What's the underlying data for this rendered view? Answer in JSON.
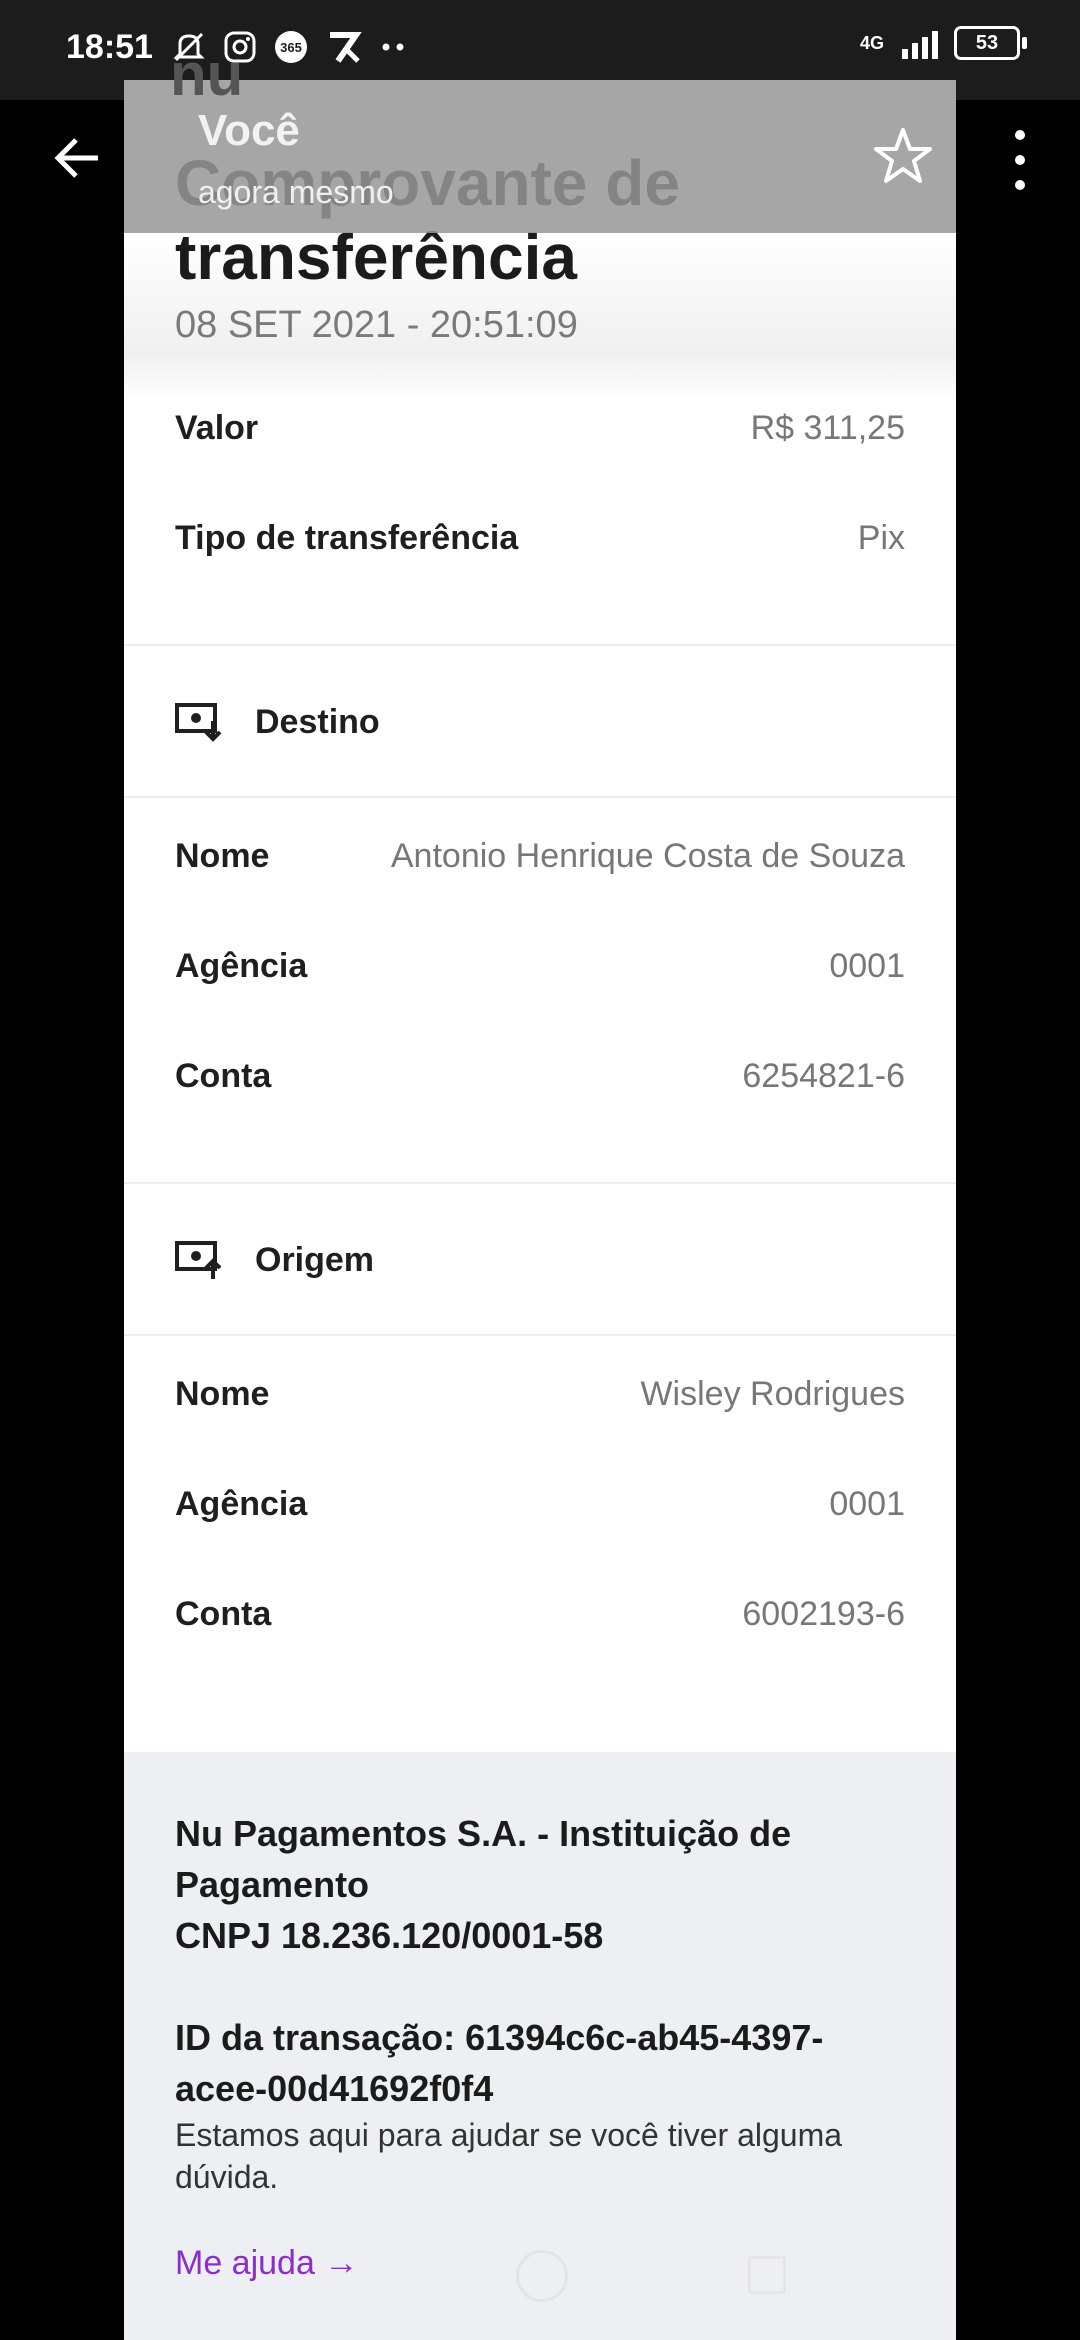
{
  "status_bar": {
    "time": "18:51",
    "icons": [
      "mute-bell-icon",
      "instagram-icon",
      "app-365-icon",
      "app-7-icon",
      "more-dots-icon"
    ],
    "network": "4G",
    "battery": "53"
  },
  "overlay": {
    "title": "Você",
    "subtitle": "agora mesmo"
  },
  "toolbar": {
    "back_icon": "arrow-left-icon",
    "star_icon": "star-outline-icon",
    "menu_icon": "more-vertical-icon"
  },
  "receipt": {
    "title": "Comprovante de transferência",
    "date": "08 SET 2021 - 20:51:09",
    "value_label": "Valor",
    "value": "R$ 311,25",
    "type_label": "Tipo de transferência",
    "type_value": "Pix"
  },
  "destino": {
    "heading": "Destino",
    "name_label": "Nome",
    "name": "Antonio Henrique Costa de Souza",
    "agency_label": "Agência",
    "agency": "0001",
    "account_label": "Conta",
    "account": "6254821-6"
  },
  "origem": {
    "heading": "Origem",
    "name_label": "Nome",
    "name": "Wisley Rodrigues",
    "agency_label": "Agência",
    "agency": "0001",
    "account_label": "Conta",
    "account": "6002193-6"
  },
  "footer": {
    "company": "Nu Pagamentos S.A. - Instituição de Pagamento",
    "cnpj": "CNPJ 18.236.120/0001-58",
    "transaction_id": "ID da transação: 61394c6c-ab45-4397-acee-00d41692f0f4",
    "help_text": "Estamos aqui para ajudar se você tiver alguma dúvida.",
    "help_link": "Me ajuda →"
  },
  "colors": {
    "link": "#8a2ecc",
    "footer_bg": "#eeeff3"
  }
}
